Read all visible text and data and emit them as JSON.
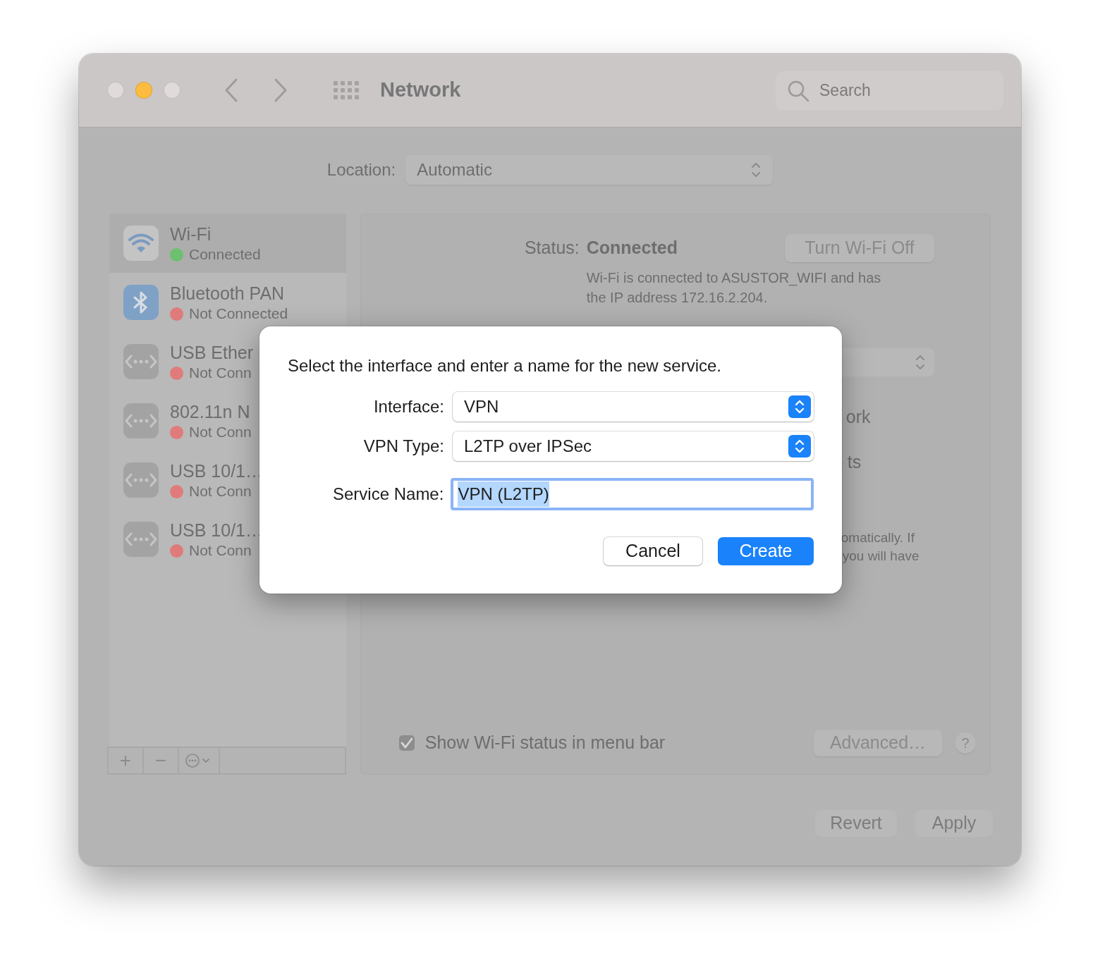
{
  "window": {
    "title": "Network",
    "traffic_lights": [
      {
        "color": "#e0dada"
      },
      {
        "color": "#fdbc40"
      },
      {
        "color": "#e0dada"
      }
    ],
    "search": {
      "placeholder": "Search"
    }
  },
  "location": {
    "label": "Location:",
    "value": "Automatic"
  },
  "services": [
    {
      "kind": "wifi",
      "name": "Wi-Fi",
      "status": "Connected",
      "color": "#6cc070",
      "selected": true
    },
    {
      "kind": "bluetooth",
      "name": "Bluetooth PAN",
      "status": "Not Connected",
      "color": "#e07b7b",
      "selected": false
    },
    {
      "kind": "ethernet",
      "name": "USB Ether",
      "status": "Not Conn",
      "color": "#e07b7b",
      "selected": false
    },
    {
      "kind": "ethernet",
      "name": "802.11n N",
      "status": "Not Conn",
      "color": "#e07b7b",
      "selected": false
    },
    {
      "kind": "ethernet",
      "name": "USB 10/1…",
      "status": "Not Conn",
      "color": "#e07b7b",
      "selected": false
    },
    {
      "kind": "ethernet",
      "name": "USB 10/1…",
      "status": "Not Conn",
      "color": "#e07b7b",
      "selected": false
    }
  ],
  "service_toolbar": {
    "add": "+",
    "remove": "−"
  },
  "detail": {
    "status_label": "Status:",
    "status_value": "Connected",
    "toggle_button": "Turn Wi-Fi Off",
    "description": "Wi-Fi is connected to ASUSTOR_WIFI and has\nthe IP address 172.16.2.204.",
    "partial_texts": [
      "ork",
      "ts",
      "omatically. If",
      "you will have"
    ],
    "show_status": {
      "label": "Show Wi-Fi status in menu bar",
      "checked": true
    },
    "advanced_button": "Advanced…",
    "help_button": "?"
  },
  "footer_buttons": [
    "Revert",
    "Apply"
  ],
  "dialog": {
    "message": "Select the interface and enter a name for the new service.",
    "fields": [
      {
        "kind": "popup",
        "label": "Interface:",
        "value": "VPN"
      },
      {
        "kind": "popup",
        "label": "VPN Type:",
        "value": "L2TP over IPSec"
      },
      {
        "kind": "text",
        "label": "Service Name:",
        "value": "VPN (L2TP)",
        "text_selected": true
      }
    ],
    "buttons": [
      {
        "label": "Cancel",
        "kind": "normal"
      },
      {
        "label": "Create",
        "kind": "primary"
      }
    ]
  }
}
